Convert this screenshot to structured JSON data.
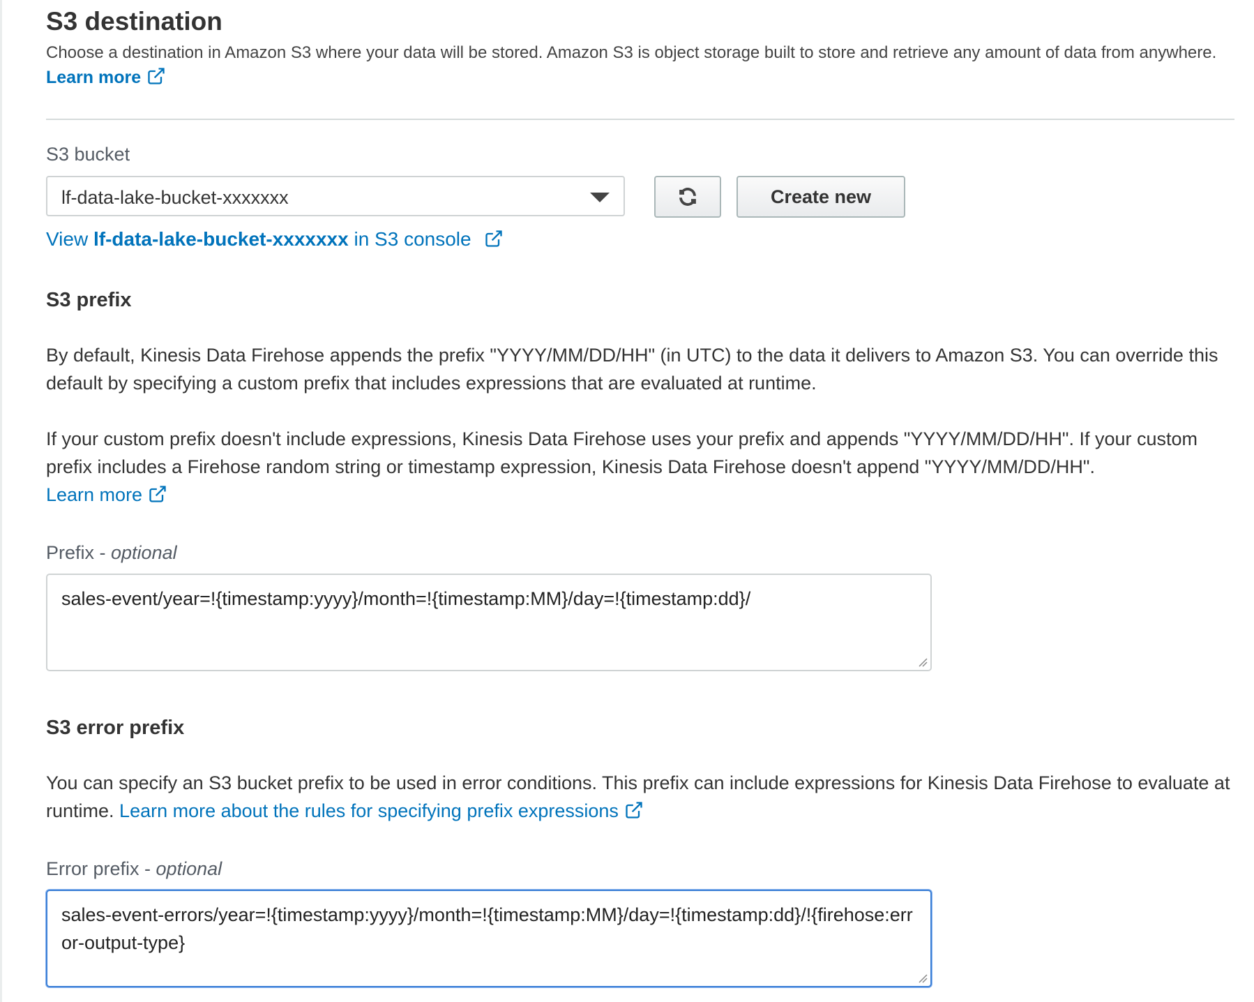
{
  "header": {
    "title": "S3 destination",
    "description": "Choose a destination in Amazon S3 where your data will be stored. Amazon S3 is object storage built to store and retrieve any amount of data from anywhere.",
    "learn_more": "Learn more"
  },
  "bucket": {
    "label": "S3 bucket",
    "selected": "lf-data-lake-bucket-xxxxxxx",
    "create_new": "Create new",
    "view_prefix": "View ",
    "view_bucket": "lf-data-lake-bucket-xxxxxxx",
    "view_suffix": " in S3 console"
  },
  "prefix_section": {
    "heading": "S3 prefix",
    "para1": "By default, Kinesis Data Firehose appends the prefix \"YYYY/MM/DD/HH\" (in UTC) to the data it delivers to Amazon S3. You can override this default by specifying a custom prefix that includes expressions that are evaluated at runtime.",
    "para2": "If your custom prefix doesn't include expressions, Kinesis Data Firehose uses your prefix and appends \"YYYY/MM/DD/HH\". If your custom prefix includes a Firehose random string or timestamp expression, Kinesis Data Firehose doesn't append \"YYYY/MM/DD/HH\".",
    "learn_more": "Learn more",
    "field_label": "Prefix - ",
    "field_optional": "optional",
    "value": "sales-event/year=!{timestamp:yyyy}/month=!{timestamp:MM}/day=!{timestamp:dd}/"
  },
  "error_section": {
    "heading": "S3 error prefix",
    "para_text": "You can specify an S3 bucket prefix to be used in error conditions. This prefix can include expressions for Kinesis Data Firehose to evaluate at runtime. ",
    "para_link": "Learn more about the rules for specifying prefix expressions",
    "field_label": "Error prefix - ",
    "field_optional": "optional",
    "value": "sales-event-errors/year=!{timestamp:yyyy}/month=!{timestamp:MM}/day=!{timestamp:dd}/!{firehose:error-output-type}"
  },
  "icons": {
    "external_link": "external-link-icon",
    "refresh": "refresh-icon",
    "dropdown": "caret-down-icon"
  },
  "colors": {
    "link": "#0073bb",
    "focus": "#3b7fd6"
  }
}
